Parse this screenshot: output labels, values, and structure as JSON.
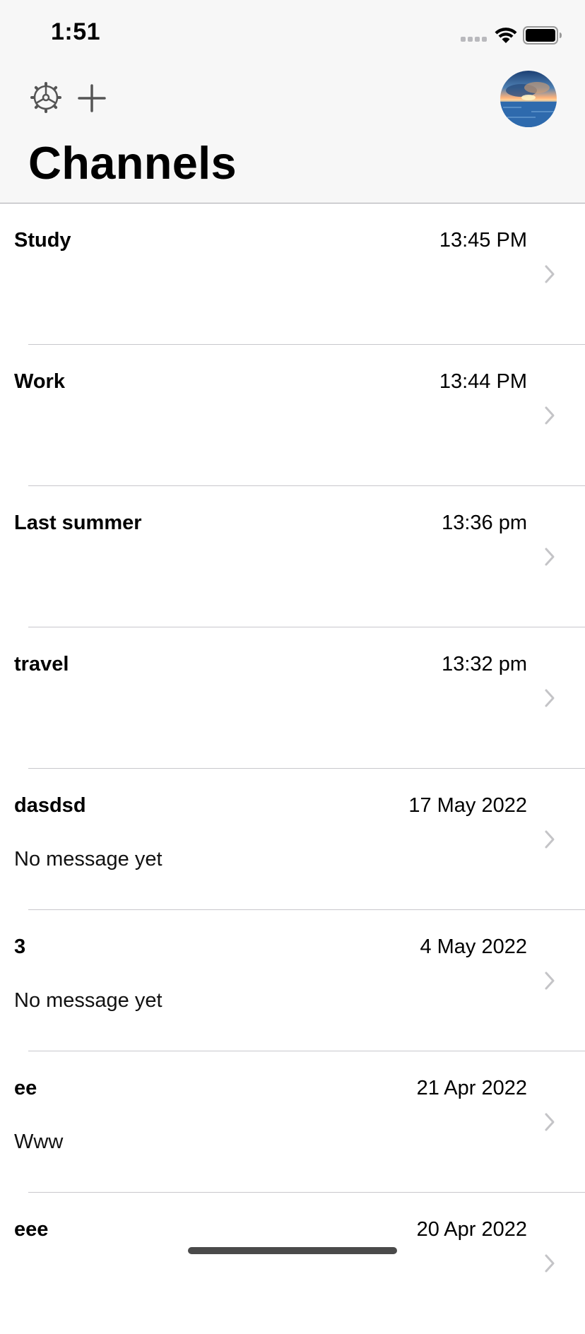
{
  "status_bar": {
    "time": "1:51"
  },
  "header": {
    "title": "Channels",
    "icons": {
      "settings": "gear-icon",
      "add": "plus-icon",
      "avatar": "avatar"
    }
  },
  "channels": [
    {
      "name": "Study",
      "time": "13:45 PM",
      "message": ""
    },
    {
      "name": "Work",
      "time": "13:44 PM",
      "message": ""
    },
    {
      "name": "Last summer",
      "time": "13:36 pm",
      "message": ""
    },
    {
      "name": "travel",
      "time": "13:32 pm",
      "message": ""
    },
    {
      "name": "dasdsd",
      "time": "17 May 2022",
      "message": "No message yet"
    },
    {
      "name": "3",
      "time": "4 May 2022",
      "message": "No message yet"
    },
    {
      "name": "ee",
      "time": "21 Apr 2022",
      "message": "Www"
    },
    {
      "name": "eee",
      "time": "20 Apr 2022",
      "message": ""
    }
  ],
  "colors": {
    "header_background": "#f7f7f7",
    "separator": "#c8c7cc",
    "chevron": "#c4c4c7",
    "icon": "#555555"
  }
}
